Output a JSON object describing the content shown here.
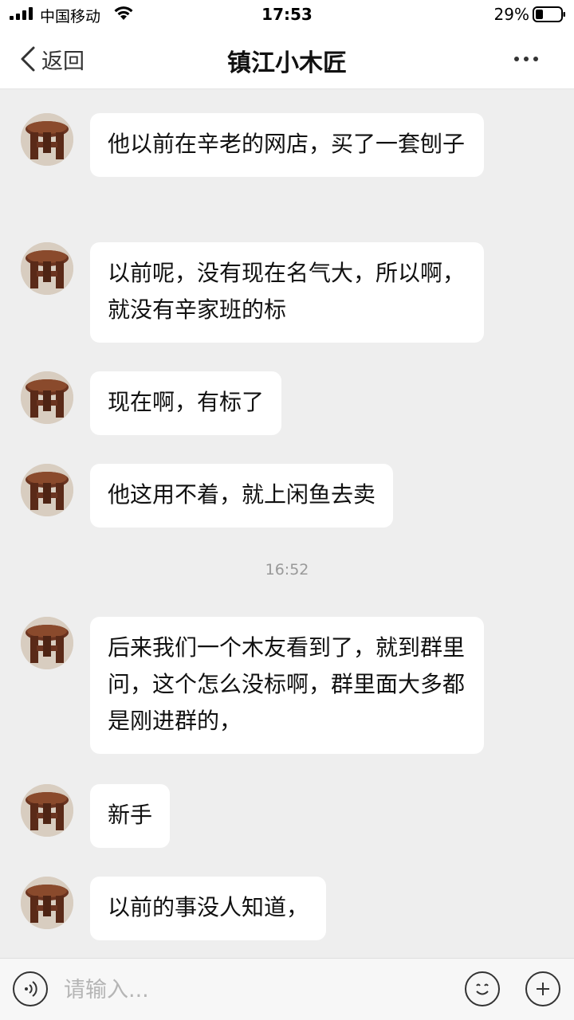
{
  "status_bar": {
    "carrier": "中国移动",
    "time": "17:53",
    "battery_pct": "29%",
    "icons": [
      "signal-icon",
      "wifi-icon",
      "battery-icon"
    ]
  },
  "nav": {
    "back_label": "返回",
    "title": "镇江小木匠",
    "back_icon": "chevron-left-icon",
    "more_icon": "more-dots-icon"
  },
  "messages": [
    {
      "avatar": "stool-avatar",
      "text": "他以前在辛老的网店，买了一套刨子"
    },
    {
      "avatar": "stool-avatar",
      "text": "以前呢，没有现在名气大，所以啊，就没有辛家班的标"
    },
    {
      "avatar": "stool-avatar",
      "text": "现在啊，有标了"
    },
    {
      "avatar": "stool-avatar",
      "text": "他这用不着，就上闲鱼去卖"
    },
    {
      "avatar": "stool-avatar",
      "text": "后来我们一个木友看到了，就到群里问，这个怎么没标啊，群里面大多都 是刚进群的，"
    },
    {
      "avatar": "stool-avatar",
      "text": "新手"
    },
    {
      "avatar": "stool-avatar",
      "text": "以前的事没人知道，"
    }
  ],
  "timestamp": "16:52",
  "input": {
    "placeholder": "请输入...",
    "value": "",
    "icons": [
      "voice-icon",
      "emoji-icon",
      "plus-icon"
    ]
  },
  "colors": {
    "chat_bg": "#eeeeee",
    "bubble_bg": "#ffffff",
    "bar_bg": "#ffffff",
    "timestamp": "#999999"
  }
}
